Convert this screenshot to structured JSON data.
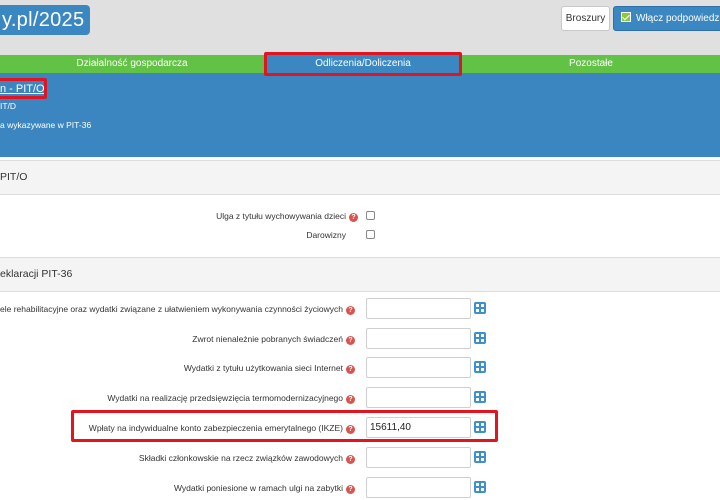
{
  "header": {
    "logo_text": "y.pl/2025",
    "broszury_label": "Broszury",
    "hints_label": "Włącz podpowiedzi"
  },
  "tabs": [
    {
      "label": "Działalność gospodarcza"
    },
    {
      "label": "Odliczenia/Doliczenia"
    },
    {
      "label": "Pozostałe"
    }
  ],
  "banner": {
    "title": "n - PIT/O",
    "line1": "IT/D",
    "line2": "a wykazywane w PIT-36"
  },
  "section1": {
    "title": "PIT/O",
    "rows": [
      {
        "label": "Ulga z tytułu wychowywania dzieci",
        "has_help": true
      },
      {
        "label": "Darowizny",
        "has_help": false
      }
    ]
  },
  "section2": {
    "title": "eklaracji PIT-36",
    "rows": [
      {
        "label": "cele rehabilitacyjne oraz wydatki związane z ułatwieniem wykonywania czynności życiowych",
        "value": ""
      },
      {
        "label": "Zwrot nienależnie pobranych świadczeń",
        "value": ""
      },
      {
        "label": "Wydatki z tytułu użytkowania sieci Internet",
        "value": ""
      },
      {
        "label": "Wydatki na realizację przedsięwzięcia termomodernizacyjnego",
        "value": ""
      },
      {
        "label": "Wpłaty na indywidualne konto zabezpieczenia emerytalnego (IKZE)",
        "value": "15611,40"
      },
      {
        "label": "Składki członkowskie na rzecz związków zawodowych",
        "value": ""
      },
      {
        "label": "Wydatki poniesione w ramach ulgi na zabytki",
        "value": ""
      }
    ]
  },
  "colors": {
    "brand_blue": "#3a87c2",
    "tab_green": "#62c245",
    "highlight_red": "#e2141f",
    "help_red": "#d9534f"
  },
  "icons": {
    "help": "question-circle-icon",
    "calculator": "calculator-icon",
    "checkbox_checked": "check-icon"
  }
}
